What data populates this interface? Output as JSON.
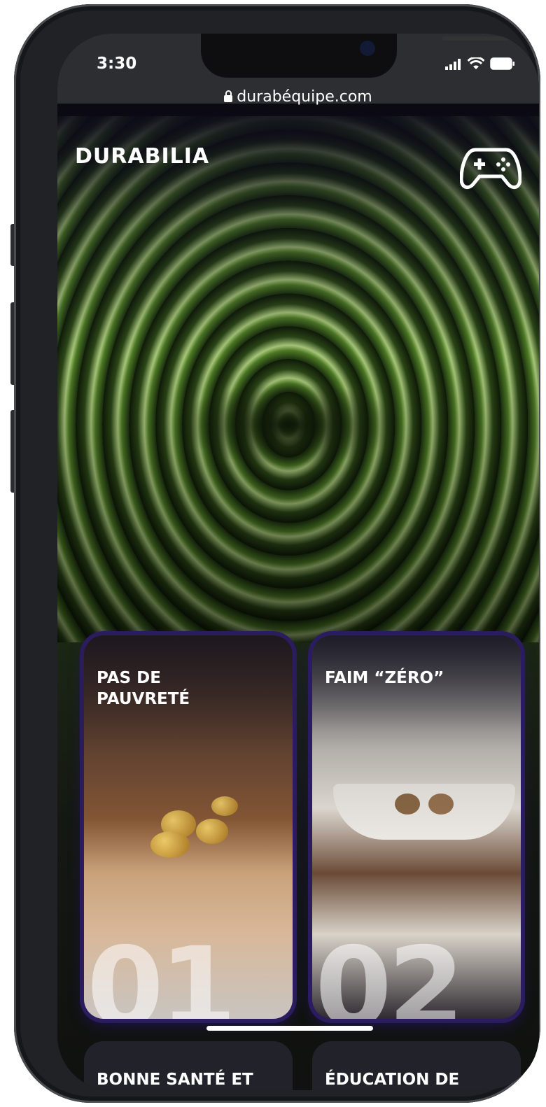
{
  "status_bar": {
    "time": "3:30"
  },
  "browser": {
    "url": "durabéquipe.com"
  },
  "header": {
    "brand": "DURABILIA",
    "game_icon": "gamepad-icon"
  },
  "cards": [
    {
      "title_line1": "PAS DE",
      "title_line2": "PAUVRETÉ",
      "number": "01"
    },
    {
      "title_line1": "FAIM “ZÉRO”",
      "title_line2": "",
      "number": "02"
    }
  ],
  "next_cards": [
    {
      "title": "BONNE SANTÉ ET"
    },
    {
      "title": "ÉDUCATION DE"
    }
  ],
  "colors": {
    "card_glow": "#2b1c60",
    "accent": "#ffffff"
  }
}
